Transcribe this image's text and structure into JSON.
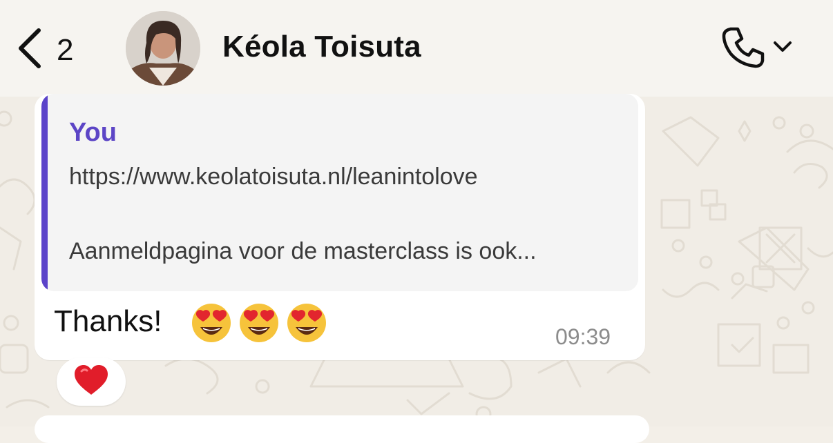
{
  "header": {
    "back_count": "2",
    "contact_name": "Kéola Toisuta"
  },
  "message": {
    "quoted": {
      "author": "You",
      "link": "https://www.keolatoisuta.nl/leanintolove",
      "snippet": "Aanmeldpagina voor de masterclass is ook..."
    },
    "text": "Thanks!",
    "emojis": [
      "heart-eyes-emoji",
      "heart-eyes-emoji",
      "heart-eyes-emoji"
    ],
    "time": "09:39",
    "reaction": "red-heart"
  },
  "colors": {
    "accent_purple": "#5c45c6",
    "chat_background": "#f1ede6",
    "bubble": "#ffffff",
    "quote_background": "#f4f4f4"
  },
  "icons": {
    "back": "chevron-left-icon",
    "call": "phone-icon",
    "call_menu": "chevron-down-icon",
    "reaction": "heart-icon"
  }
}
